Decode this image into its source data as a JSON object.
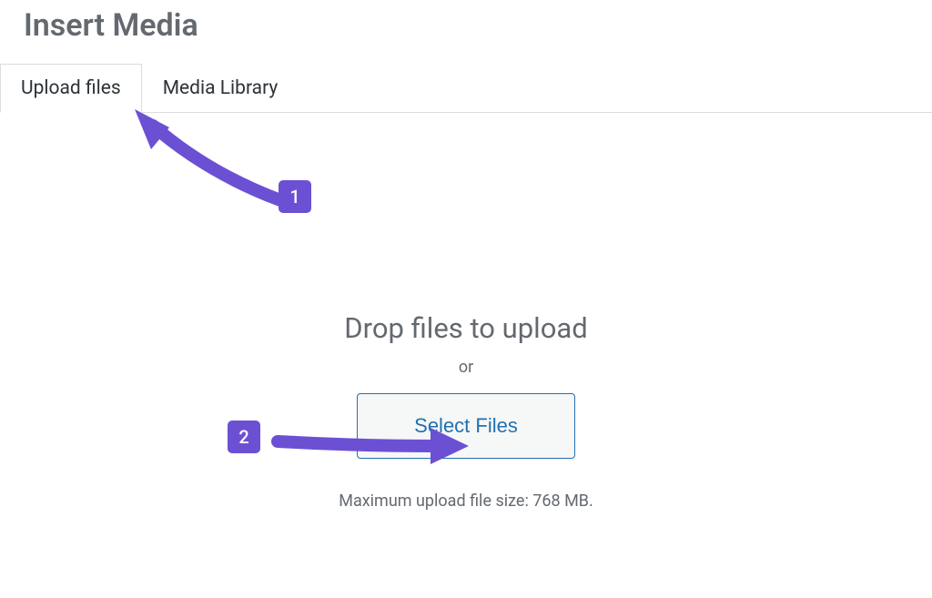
{
  "header": {
    "title": "Insert Media"
  },
  "tabs": {
    "upload": "Upload files",
    "library": "Media Library"
  },
  "upload": {
    "drop_text": "Drop files to upload",
    "or_text": "or",
    "select_button": "Select Files",
    "max_size": "Maximum upload file size: 768 MB."
  },
  "annotations": {
    "badge1": "1",
    "badge2": "2"
  }
}
